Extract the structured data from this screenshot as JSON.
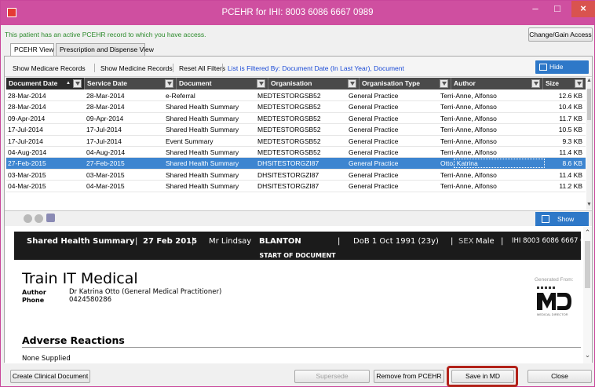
{
  "window": {
    "title": "PCEHR for IHI: 8003 6086 6667 0989",
    "minimize": "–",
    "maximize": "□",
    "close": "×"
  },
  "access_message": "This patient has an active PCEHR record to which you have access.",
  "change_access_label": "Change/Gain Access",
  "tabs": [
    {
      "label": "PCEHR View",
      "active": true
    },
    {
      "label": "Prescription and Dispense View",
      "active": false
    }
  ],
  "filterbar": {
    "show_medicare": "Show Medicare Records",
    "show_medicine": "Show Medicine Records",
    "reset_filters": "Reset All Filters",
    "filter_status": "List is Filtered By: Document Date (In Last Year), Document",
    "hide_preview": "Hide Preview"
  },
  "grid": {
    "columns": [
      "Document Date",
      "Service Date",
      "Document",
      "Organisation",
      "Organisation Type",
      "Author",
      "Size"
    ],
    "rows": [
      [
        "28-Mar-2014",
        "28-Mar-2014",
        "e-Referral",
        "MEDTESTORGSB52",
        "General Practice",
        "Terri-Anne, Alfonso",
        "12.6 KB"
      ],
      [
        "28-Mar-2014",
        "28-Mar-2014",
        "Shared Health Summary",
        "MEDTESTORGSB52",
        "General Practice",
        "Terri-Anne, Alfonso",
        "10.4 KB"
      ],
      [
        "09-Apr-2014",
        "09-Apr-2014",
        "Shared Health Summary",
        "MEDTESTORGSB52",
        "General Practice",
        "Terri-Anne, Alfonso",
        "11.7 KB"
      ],
      [
        "17-Jul-2014",
        "17-Jul-2014",
        "Shared Health Summary",
        "MEDTESTORGSB52",
        "General Practice",
        "Terri-Anne, Alfonso",
        "10.5 KB"
      ],
      [
        "17-Jul-2014",
        "17-Jul-2014",
        "Event Summary",
        "MEDTESTORGSB52",
        "General Practice",
        "Terri-Anne, Alfonso",
        "9.3 KB"
      ],
      [
        "04-Aug-2014",
        "04-Aug-2014",
        "Shared Health Summary",
        "MEDTESTORGSB52",
        "General Practice",
        "Terri-Anne, Alfonso",
        "11.4 KB"
      ],
      [
        "27-Feb-2015",
        "27-Feb-2015",
        "Shared Health Summary",
        "DHSITESTORGZI87",
        "General Practice",
        "Otto, Katrina",
        "8.6 KB"
      ],
      [
        "03-Mar-2015",
        "03-Mar-2015",
        "Shared Health Summary",
        "DHSITESTORGZI87",
        "General Practice",
        "Terri-Anne, Alfonso",
        "11.4 KB"
      ],
      [
        "04-Mar-2015",
        "04-Mar-2015",
        "Shared Health Summary",
        "DHSITESTORGZI87",
        "General Practice",
        "Terri-Anne, Alfonso",
        "11.2 KB"
      ]
    ],
    "selected_row": 6,
    "sort_indicator": "▲"
  },
  "preview_bar": {
    "show_more": "Show More"
  },
  "document": {
    "banner": {
      "doc_type": "Shared Health Summary",
      "sep1": "|",
      "date": "27 Feb 2015",
      "sep2": "|",
      "patient_prefix": "Mr Lindsay",
      "patient_surname": "BLANTON",
      "sep3": "|",
      "dob": "DoB 1 Oct 1991 (23y)",
      "sep4": "|",
      "sex_label": "SEX",
      "sex_value": "Male",
      "sep5": "|",
      "ihi": "IHI 8003 6086 6667 0989"
    },
    "start_label": "START OF DOCUMENT",
    "org_name": "Train IT Medical",
    "author_label": "Author",
    "author_value": "Dr Katrina Otto (General Medical Practitioner)",
    "phone_label": "Phone",
    "phone_value": "0424580286",
    "generated_from": "Generated From:",
    "logo_tagline": "MEDICAL DIRECTOR",
    "section_title": "Adverse Reactions",
    "section_body": "None Supplied"
  },
  "footer": {
    "create": "Create Clinical Document",
    "supersede": "Supersede",
    "remove": "Remove from PCEHR",
    "save": "Save in MD",
    "close": "Close"
  },
  "colors": {
    "titlebar": "#cf4fa0",
    "selection": "#3d85d0",
    "highlight": "#b2221a",
    "access_message": "#2b8a2b",
    "filter_status": "#1a4ad6"
  }
}
